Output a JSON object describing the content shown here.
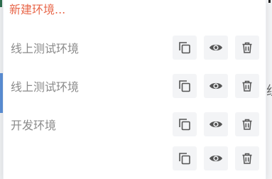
{
  "dropdown": {
    "create_label": "新建环境...",
    "environments": [
      {
        "name": "线上测试环境"
      },
      {
        "name": "线上测试环境"
      },
      {
        "name": "开发环境"
      },
      {
        "name": ""
      }
    ],
    "icons": {
      "copy": "copy-icon",
      "view": "eye-icon",
      "delete": "trash-icon"
    }
  },
  "background": {
    "right_glyph": "组"
  },
  "colors": {
    "create_link": "#e8674a",
    "env_name": "#8a8a8a",
    "icon": "#555555",
    "button_bg": "#f3f4f6"
  }
}
